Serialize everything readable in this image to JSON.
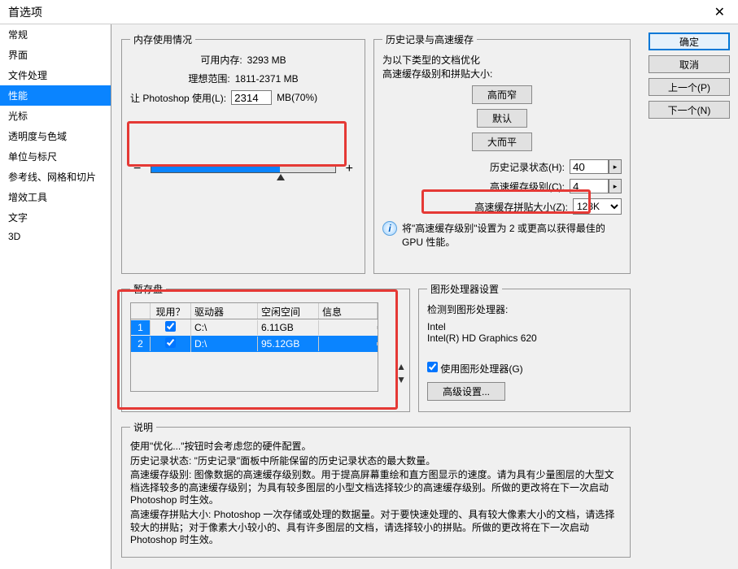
{
  "title": "首选项",
  "sidebar": [
    "常规",
    "界面",
    "文件处理",
    "性能",
    "光标",
    "透明度与色域",
    "单位与标尺",
    "参考线、网格和切片",
    "增效工具",
    "文字",
    "3D"
  ],
  "sidebarSelected": 3,
  "buttons": {
    "ok": "确定",
    "cancel": "取消",
    "prev": "上一个(P)",
    "next": "下一个(N)"
  },
  "memory": {
    "legend": "内存使用情况",
    "avail_label": "可用内存:",
    "avail_val": "3293 MB",
    "ideal_label": "理想范围:",
    "ideal_val": "1811-2371 MB",
    "use_label": "让 Photoshop 使用(L):",
    "use_val": "2314",
    "use_suffix": "MB(70%)"
  },
  "history": {
    "legend": "历史记录与高速缓存",
    "intro": "为以下类型的文档优化\n高速缓存级别和拼贴大小:",
    "btn1": "高而窄",
    "btn2": "默认",
    "btn3": "大而平",
    "states_label": "历史记录状态(H):",
    "states_val": "40",
    "levels_label": "高速缓存级别(C):",
    "levels_val": "4",
    "tile_label": "高速缓存拼贴大小(Z):",
    "tile_val": "128K",
    "tip": "将\"高速缓存级别\"设置为 2 或更高以获得最佳的 GPU 性能。"
  },
  "scratch": {
    "legend": "暂存盘",
    "cols": [
      "",
      "现用？",
      "驱动器",
      "空闲空间",
      "信息"
    ],
    "rows": [
      {
        "n": "1",
        "active": true,
        "drive": "C:\\",
        "free": "6.11GB",
        "info": ""
      },
      {
        "n": "2",
        "active": true,
        "drive": "D:\\",
        "free": "95.12GB",
        "info": ""
      }
    ],
    "selectedRow": 1
  },
  "gpu": {
    "legend": "图形处理器设置",
    "detect": "检测到图形处理器:",
    "vendor": "Intel",
    "model": "Intel(R) HD Graphics 620",
    "use_label": "使用图形处理器(G)",
    "use_checked": true,
    "adv": "高级设置..."
  },
  "desc": {
    "legend": "说明",
    "p1": "使用\"优化...\"按钮时会考虑您的硬件配置。",
    "p2": "历史记录状态: \"历史记录\"面板中所能保留的历史记录状态的最大数量。",
    "p3": "高速缓存级别: 图像数据的高速缓存级别数。用于提高屏幕重绘和直方图显示的速度。请为具有少量图层的大型文档选择较多的高速缓存级别；为具有较多图层的小型文档选择较少的高速缓存级别。所做的更改将在下一次启动 Photoshop 时生效。",
    "p4": "高速缓存拼贴大小: Photoshop 一次存储或处理的数据量。对于要快速处理的、具有较大像素大小的文档，请选择较大的拼贴；对于像素大小较小的、具有许多图层的文档，请选择较小的拼贴。所做的更改将在下一次启动 Photoshop 时生效。"
  }
}
